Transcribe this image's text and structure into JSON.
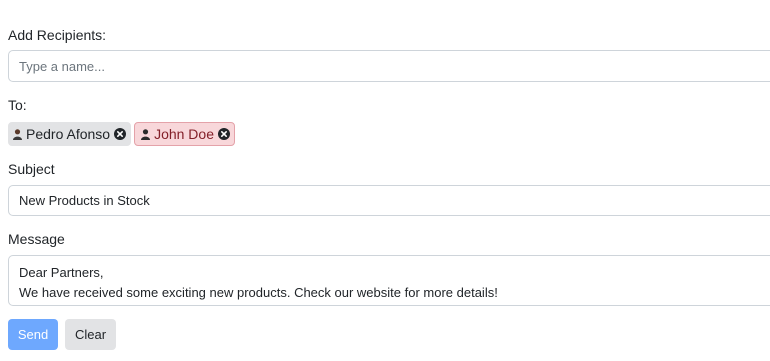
{
  "recipients": {
    "label": "Add Recipients:",
    "placeholder": "Type a name..."
  },
  "to": {
    "label": "To:",
    "chips": [
      {
        "name": "Pedro Afonso",
        "icon": "person-icon",
        "style": "gray"
      },
      {
        "name": "John Doe",
        "icon": "person-icon",
        "style": "danger"
      }
    ]
  },
  "subject": {
    "label": "Subject",
    "value": "New Products in Stock"
  },
  "message": {
    "label": "Message",
    "lines": [
      "Dear Partners,",
      "We have received some exciting new products. Check our website for more details!"
    ]
  },
  "buttons": {
    "send": "Send",
    "clear": "Clear"
  },
  "colors": {
    "send_button": "#6ea8fe",
    "clear_button": "#e2e3e5",
    "chip_gray": "#e2e3e5",
    "chip_danger": "#f8d7da"
  }
}
